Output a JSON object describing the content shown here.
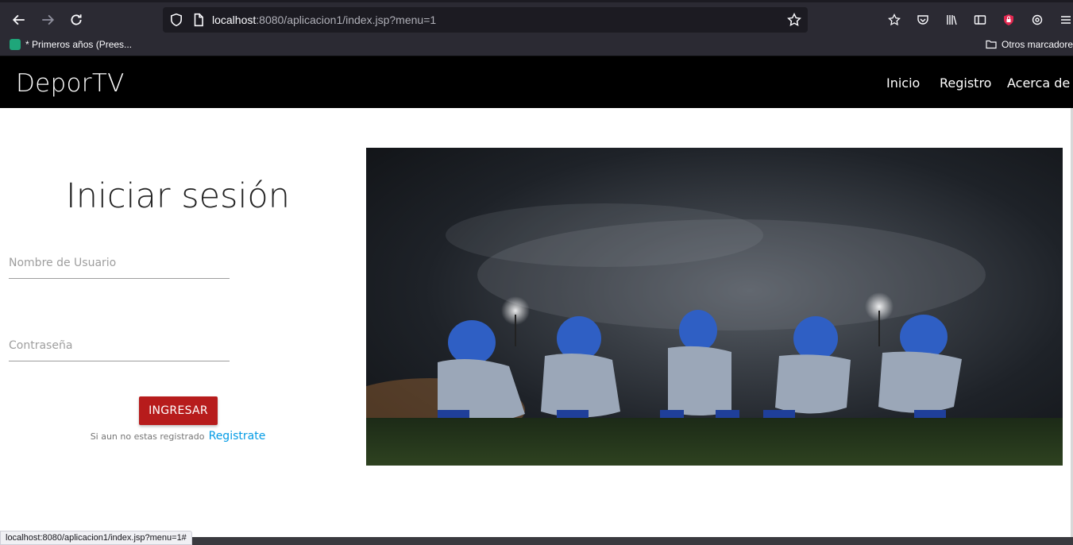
{
  "browser": {
    "url_host": "localhost",
    "url_rest": ":8080/aplicacion1/index.jsp?menu=1",
    "bookmark_label": "* Primeros años (Prees...",
    "other_bookmarks": "Otros marcadores",
    "status_url": "localhost:8080/aplicacion1/index.jsp?menu=1#"
  },
  "site": {
    "brand": "DeporTV",
    "nav": [
      "Inicio",
      "Registro",
      "Acerca de"
    ]
  },
  "login": {
    "title": "Iniciar sesión",
    "username_placeholder": "Nombre de Usuario",
    "password_placeholder": "Contraseña",
    "submit_label": "INGRESAR",
    "register_hint": "Si aun no estas registrado",
    "register_link": "Registrate"
  },
  "colors": {
    "navbar": "#000000",
    "button": "#b71c1c",
    "link": "#039be5"
  }
}
